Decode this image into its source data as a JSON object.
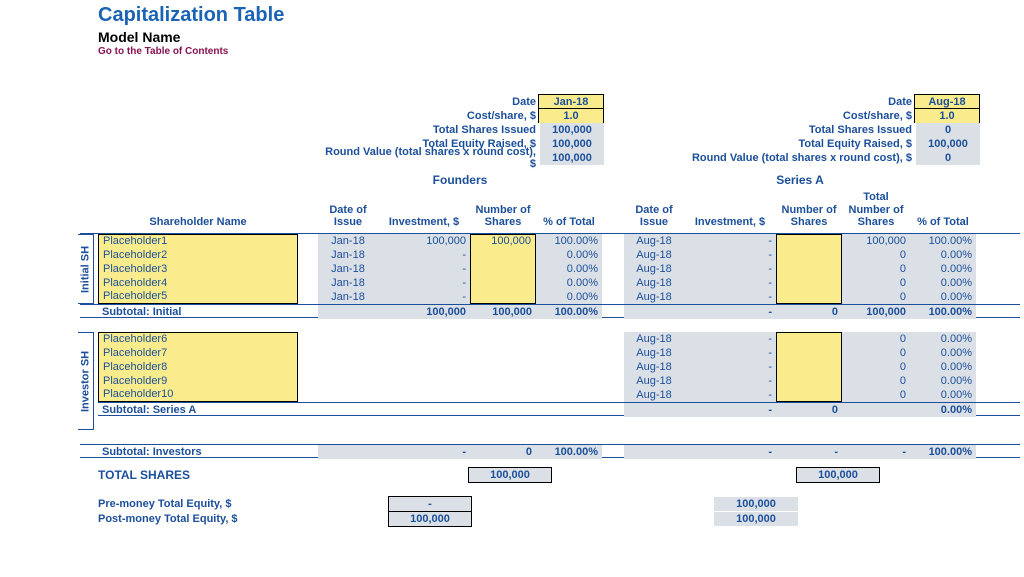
{
  "header": {
    "title": "Capitalization Table",
    "subtitle": "Model Name",
    "toc": "Go to the Table of Contents"
  },
  "summaryLabels": {
    "date": "Date",
    "cost": "Cost/share, $",
    "shares": "Total Shares Issued",
    "equity": "Total Equity Raised, $",
    "round": "Round Value (total shares x round cost), $"
  },
  "founders": {
    "title": "Founders",
    "summary": {
      "date": "Jan-18",
      "cost": "1.0",
      "shares": "100,000",
      "equity": "100,000",
      "round": "100,000"
    },
    "headers": {
      "date": "Date of Issue",
      "inv": "Investment, $",
      "num": "Number of Shares",
      "pct": "% of Total"
    }
  },
  "seriesA": {
    "title": "Series A",
    "summary": {
      "date": "Aug-18",
      "cost": "1.0",
      "shares": "0",
      "equity": "100,000",
      "round": "0"
    },
    "headers": {
      "date": "Date of Issue",
      "inv": "Investment, $",
      "num": "Number of Shares",
      "totnum": "Total Number of Shares",
      "pct": "% of Total"
    }
  },
  "shareholderHeader": "Shareholder Name",
  "sideLabels": {
    "initial": "Initial SH",
    "investor": "Investor SH"
  },
  "initial": [
    {
      "name": "Placeholder1",
      "f": {
        "date": "Jan-18",
        "inv": "100,000",
        "num": "100,000",
        "pct": "100.00%"
      },
      "a": {
        "date": "Aug-18",
        "inv": "-",
        "num": "",
        "tot": "100,000",
        "pct": "100.00%"
      }
    },
    {
      "name": "Placeholder2",
      "f": {
        "date": "Jan-18",
        "inv": "-",
        "num": "",
        "pct": "0.00%"
      },
      "a": {
        "date": "Aug-18",
        "inv": "-",
        "num": "",
        "tot": "0",
        "pct": "0.00%"
      }
    },
    {
      "name": "Placeholder3",
      "f": {
        "date": "Jan-18",
        "inv": "-",
        "num": "",
        "pct": "0.00%"
      },
      "a": {
        "date": "Aug-18",
        "inv": "-",
        "num": "",
        "tot": "0",
        "pct": "0.00%"
      }
    },
    {
      "name": "Placeholder4",
      "f": {
        "date": "Jan-18",
        "inv": "-",
        "num": "",
        "pct": "0.00%"
      },
      "a": {
        "date": "Aug-18",
        "inv": "-",
        "num": "",
        "tot": "0",
        "pct": "0.00%"
      }
    },
    {
      "name": "Placeholder5",
      "f": {
        "date": "Jan-18",
        "inv": "-",
        "num": "",
        "pct": "0.00%"
      },
      "a": {
        "date": "Aug-18",
        "inv": "-",
        "num": "",
        "tot": "0",
        "pct": "0.00%"
      }
    }
  ],
  "initialSubtotal": {
    "label": "Subtotal: Initial",
    "f": {
      "inv": "100,000",
      "num": "100,000",
      "pct": "100.00%"
    },
    "a": {
      "inv": "-",
      "num": "0",
      "tot": "100,000",
      "pct": "100.00%"
    }
  },
  "investor": [
    {
      "name": "Placeholder6",
      "a": {
        "date": "Aug-18",
        "inv": "-",
        "num": "",
        "tot": "0",
        "pct": "0.00%"
      }
    },
    {
      "name": "Placeholder7",
      "a": {
        "date": "Aug-18",
        "inv": "-",
        "num": "",
        "tot": "0",
        "pct": "0.00%"
      }
    },
    {
      "name": "Placeholder8",
      "a": {
        "date": "Aug-18",
        "inv": "-",
        "num": "",
        "tot": "0",
        "pct": "0.00%"
      }
    },
    {
      "name": "Placeholder9",
      "a": {
        "date": "Aug-18",
        "inv": "-",
        "num": "",
        "tot": "0",
        "pct": "0.00%"
      }
    },
    {
      "name": "Placeholder10",
      "a": {
        "date": "Aug-18",
        "inv": "-",
        "num": "",
        "tot": "0",
        "pct": "0.00%"
      }
    }
  ],
  "seriesASubtotal": {
    "label": "Subtotal: Series A",
    "a": {
      "inv": "-",
      "num": "0",
      "tot": "",
      "pct": "0.00%"
    }
  },
  "investorsSubtotal": {
    "label": "Subtotal: Investors",
    "f": {
      "inv": "-",
      "num": "0",
      "pct": "100.00%"
    },
    "a": {
      "inv": "-",
      "num": "-",
      "tot": "-",
      "pct": "100.00%"
    }
  },
  "totals": {
    "sharesLabel": "TOTAL SHARES",
    "sharesF": "100,000",
    "sharesA": "100,000",
    "preLabel": "Pre-money Total Equity, $",
    "preF": "-",
    "preA": "100,000",
    "postLabel": "Post-money Total Equity, $",
    "postF": "100,000",
    "postA": "100,000"
  }
}
